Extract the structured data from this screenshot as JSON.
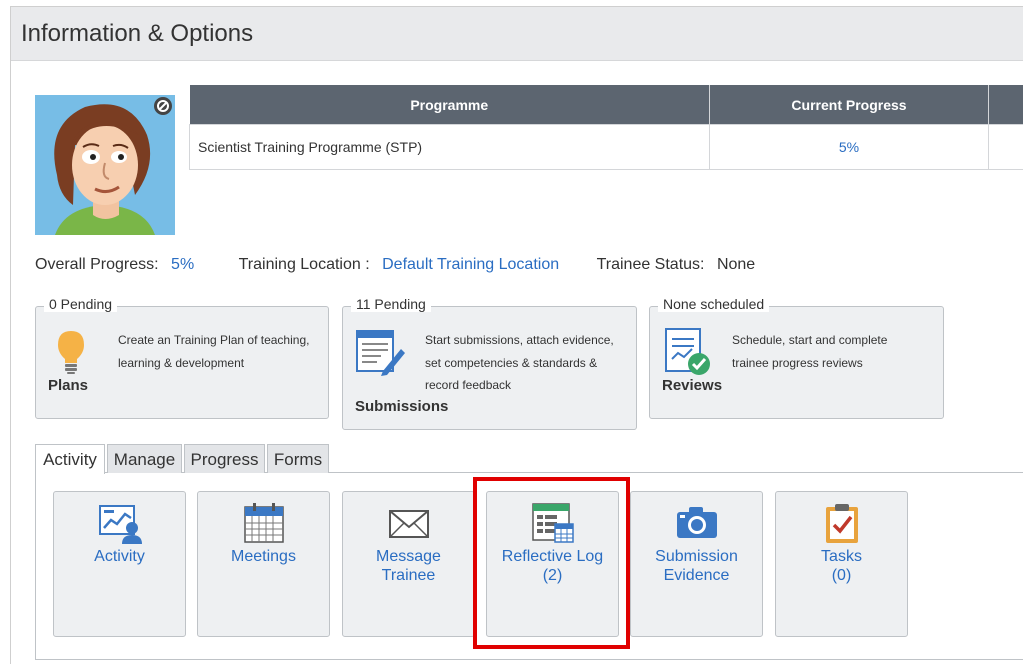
{
  "header": {
    "title": "Information & Options"
  },
  "table": {
    "columns": [
      "Programme",
      "Current Progress",
      ""
    ],
    "rows": [
      {
        "programme": "Scientist Training Programme (STP)",
        "progress": "5%"
      }
    ]
  },
  "summary": {
    "overall_label": "Overall Progress:",
    "overall_value": "5%",
    "location_label": "Training Location :",
    "location_value": "Default Training Location",
    "status_label": "Trainee Status:",
    "status_value": "None"
  },
  "info_boxes": {
    "plans": {
      "legend": "0 Pending",
      "title": "Plans",
      "desc_line1": "Create an Training Plan of teaching,",
      "desc_line2": "learning & development",
      "icon": "lightbulb-icon"
    },
    "submissions": {
      "legend": "11 Pending",
      "title": "Submissions",
      "desc_line1": "Start submissions, attach evidence,",
      "desc_line2": "set competencies & standards &",
      "desc_line3": "record feedback",
      "icon": "form-pencil-icon"
    },
    "reviews": {
      "legend": "None scheduled",
      "title": "Reviews",
      "desc_line1": "Schedule, start and complete",
      "desc_line2": "trainee progress reviews",
      "icon": "review-check-icon"
    }
  },
  "tabs": [
    "Activity",
    "Manage",
    "Progress",
    "Forms"
  ],
  "active_tab": "Activity",
  "tiles": [
    {
      "line1": "Activity",
      "line2": "",
      "icon": "activity-chart-icon"
    },
    {
      "line1": "Meetings",
      "line2": "",
      "icon": "calendar-icon"
    },
    {
      "line1": "Message",
      "line2": "Trainee",
      "icon": "envelope-icon"
    },
    {
      "line1": "Reflective Log",
      "line2": "(2)",
      "icon": "reflective-log-icon"
    },
    {
      "line1": "Submission",
      "line2": "Evidence",
      "icon": "camera-icon"
    },
    {
      "line1": "Tasks",
      "line2": "(0)",
      "icon": "clipboard-check-icon"
    }
  ],
  "colors": {
    "link": "#2a6dc2",
    "table_header": "#5c6570",
    "highlight": "#e00000"
  }
}
